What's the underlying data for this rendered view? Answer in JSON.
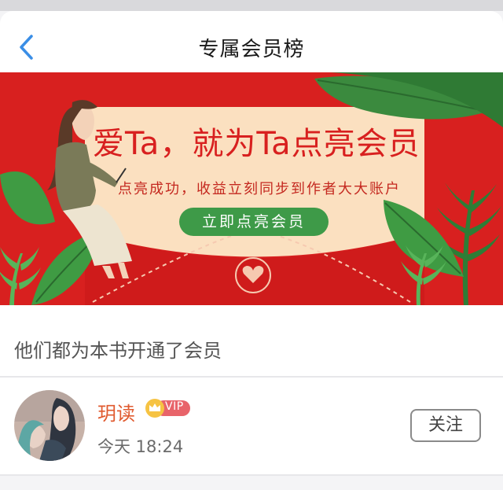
{
  "header": {
    "title": "专属会员榜",
    "back_icon": "chevron-left-icon",
    "accent_color": "#3a8ee6"
  },
  "banner": {
    "headline": "爱Ta，就为Ta点亮会员",
    "subline": "点亮成功，收益立刻同步到作者大大账户",
    "cta_label": "立即点亮会员",
    "background_color": "#d8201f",
    "cta_color": "#3e9a48"
  },
  "section": {
    "title": "他们都为本书开通了会员"
  },
  "members": [
    {
      "name": "玥读",
      "badge": "VIP",
      "time": "今天 18:24",
      "follow_label": "关注",
      "name_color": "#e05a2f"
    }
  ]
}
